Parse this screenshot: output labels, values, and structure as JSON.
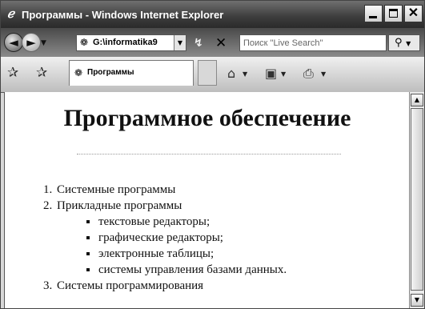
{
  "window": {
    "title": "Программы - Windows Internet Explorer",
    "ie_logo": "ℯ"
  },
  "toolbar": {
    "back_arrow": "◄",
    "forward_arrow": "►",
    "nav_dropdown": "▼",
    "address": "G:\\informatika9",
    "address_icon": "❁",
    "refresh_icon": "↯",
    "stop_icon": "✕",
    "search_placeholder": "Поиск \"Live Search\"",
    "search_icon": "⚲"
  },
  "tabs": {
    "favorites_icon": "✰",
    "add_favorites_icon": "✰",
    "active_tab_label": "Программы",
    "active_tab_icon": "❁"
  },
  "commands": {
    "home_icon": "⌂",
    "feeds_icon": "▣",
    "print_icon": "⎙",
    "dropdown": "▼"
  },
  "page": {
    "heading": "Программное обеспечение",
    "list": [
      {
        "label": "Системные программы"
      },
      {
        "label": "Прикладные программы",
        "children": [
          "текстовые редакторы;",
          "графические редакторы;",
          "электронные таблицы;",
          "системы управления базами данных."
        ]
      },
      {
        "label": "Системы программирования"
      }
    ]
  },
  "scrollbar": {
    "up": "▲",
    "down": "▼"
  }
}
